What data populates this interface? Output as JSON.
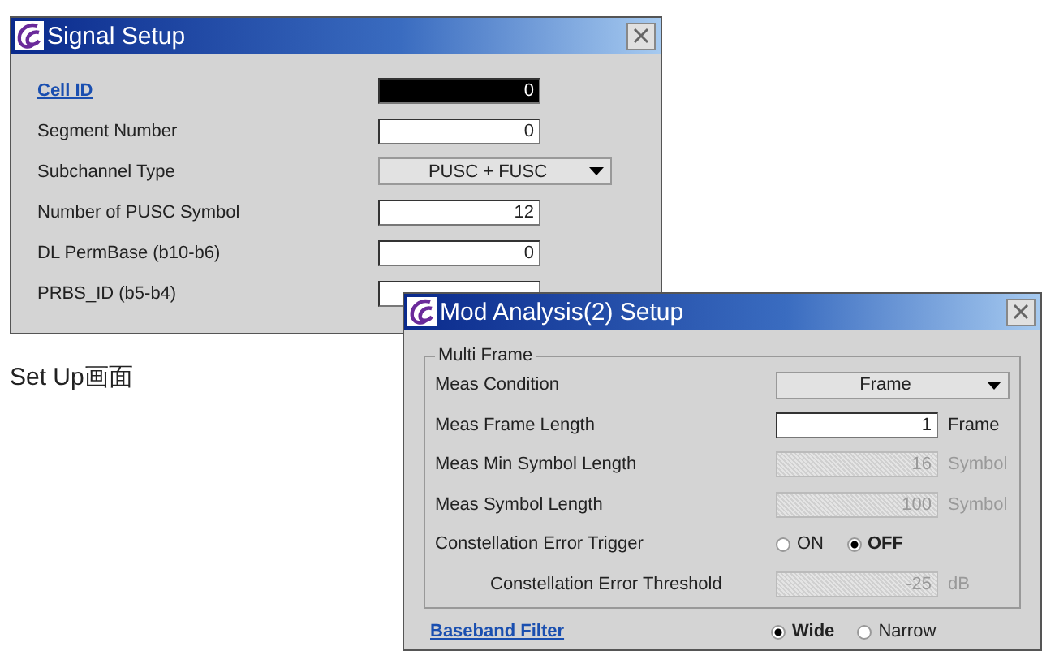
{
  "windows": [
    {
      "title": "Signal Setup",
      "rows": [
        {
          "kind": "input",
          "label": "Cell ID",
          "link": true,
          "value": "0",
          "focused": true,
          "disabled": false
        },
        {
          "kind": "input",
          "label": "Segment Number",
          "link": false,
          "value": "0",
          "focused": false,
          "disabled": false
        },
        {
          "kind": "dropdown",
          "label": "Subchannel Type",
          "link": false,
          "value": "PUSC + FUSC"
        },
        {
          "kind": "input",
          "label": "Number of PUSC Symbol",
          "link": false,
          "value": "12",
          "focused": false,
          "disabled": false
        },
        {
          "kind": "input",
          "label": "DL PermBase (b10-b6)",
          "link": false,
          "value": "0",
          "focused": false,
          "disabled": false
        },
        {
          "kind": "input",
          "label": "PRBS_ID (b5-b4)",
          "link": false,
          "focused": false,
          "disabled": false
        }
      ]
    },
    {
      "title": "Mod Analysis(2) Setup",
      "group": {
        "title": "Multi Frame",
        "rows": [
          {
            "kind": "dropdown",
            "label": "Meas Condition",
            "link": false,
            "value": "Frame"
          },
          {
            "kind": "input",
            "label": "Meas Frame Length",
            "link": false,
            "value": "1",
            "unit": "Frame",
            "focused": false,
            "disabled": false
          },
          {
            "kind": "input",
            "label": "Meas Min Symbol Length",
            "link": false,
            "value": "16",
            "unit": "Symbol",
            "focused": false,
            "disabled": true
          },
          {
            "kind": "input",
            "label": "Meas Symbol Length",
            "link": false,
            "value": "100",
            "unit": "Symbol",
            "focused": false,
            "disabled": true
          },
          {
            "kind": "radio",
            "label": "Constellation Error Trigger",
            "link": false,
            "options": [
              {
                "label": "ON",
                "selected": false
              },
              {
                "label": "OFF",
                "selected": true
              }
            ],
            "children": [
              {
                "kind": "input",
                "label": "Constellation Error Threshold",
                "link": false,
                "value": "-25",
                "unit": "dB",
                "focused": false,
                "disabled": true
              }
            ]
          }
        ]
      },
      "rows": [
        {
          "kind": "radio",
          "label": "Baseband Filter",
          "link": true,
          "options": [
            {
              "label": "Wide",
              "selected": true
            },
            {
              "label": "Narrow",
              "selected": false
            }
          ]
        }
      ]
    }
  ],
  "caption": "Set Up画面"
}
